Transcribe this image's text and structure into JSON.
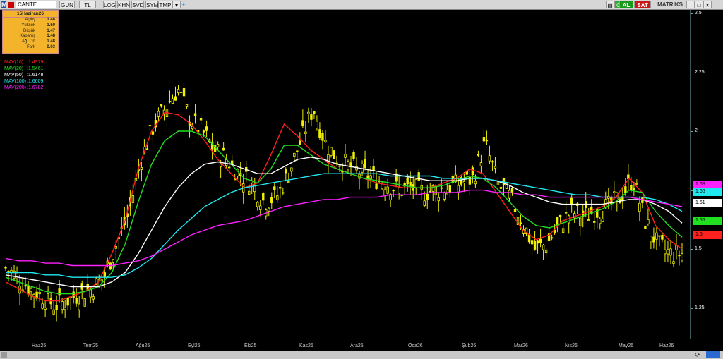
{
  "toolbar": {
    "symbol": "CANTE",
    "buttons": [
      "GUN",
      "TL",
      "LOG",
      "KHN",
      "SVD",
      "SYM",
      "TMP"
    ],
    "right_buttons": {
      "c": "C",
      "al": "AL",
      "sat": "SAT"
    },
    "brand": "MATRIKS"
  },
  "infobox": {
    "date": "15Haziran26",
    "rows": [
      {
        "k": "Açılış",
        "v": "1.48"
      },
      {
        "k": "Yüksek",
        "v": "1.50"
      },
      {
        "k": "Düşük",
        "v": "1.47"
      },
      {
        "k": "Kapanış",
        "v": "1.48"
      },
      {
        "k": "Ağ. Ort",
        "v": "1.48"
      },
      {
        "k": "Fark",
        "v": "0.03"
      }
    ]
  },
  "mav_legend": [
    {
      "name": "MAV(10)",
      "value": ":1.4979",
      "color": "#ff2020"
    },
    {
      "name": "MAV(20)",
      "value": ":1.5461",
      "color": "#20e020"
    },
    {
      "name": "MAV(50)",
      "value": ":1.6148",
      "color": "#ffffff"
    },
    {
      "name": "MAV(100)",
      "value": ":1.6609",
      "color": "#20e8f0"
    },
    {
      "name": "MAV(200)",
      "value": ":1.6782",
      "color": "#ff20ff"
    }
  ],
  "chart_data": {
    "type": "line",
    "ylim": [
      1.15,
      2.5
    ],
    "y_ticks": [
      "2.5",
      "2.25",
      "2",
      "1.75",
      "1.5",
      "1.25"
    ],
    "x_ticks": [
      "Haz25",
      "Tem25",
      "Ağu25",
      "Eyl25",
      "Eki25",
      "Kas25",
      "Ara25",
      "Oca26",
      "Şub26",
      "Mar26",
      "Nis26",
      "May26",
      "Haz26"
    ],
    "price_badges": [
      {
        "label": "1.68",
        "color": "#ff20ff"
      },
      {
        "label": "1.66",
        "color": "#20e8f0"
      },
      {
        "label": "1.61",
        "color": "#ffffff"
      },
      {
        "label": "1.55",
        "color": "#20e020"
      },
      {
        "label": "1.5",
        "color": "#ff2020"
      }
    ],
    "close_approx": [
      1.42,
      1.38,
      1.33,
      1.3,
      1.26,
      1.28,
      1.31,
      1.33,
      1.38,
      1.52,
      1.65,
      1.88,
      2.02,
      2.1,
      2.18,
      2.05,
      2.0,
      1.92,
      1.88,
      1.82,
      1.78,
      1.7,
      1.72,
      1.82,
      1.96,
      2.1,
      1.95,
      1.88,
      1.85,
      1.82,
      1.8,
      1.78,
      1.75,
      1.76,
      1.74,
      1.75,
      1.76,
      1.78,
      1.8,
      1.95,
      1.78,
      1.72,
      1.62,
      1.5,
      1.52,
      1.6,
      1.66,
      1.64,
      1.66,
      1.68,
      1.72,
      1.8,
      1.62,
      1.52,
      1.48,
      1.48
    ],
    "series": [
      {
        "name": "MAV(10)",
        "color": "#ff2020",
        "values": [
          1.36,
          1.33,
          1.3,
          1.28,
          1.28,
          1.3,
          1.32,
          1.36,
          1.48,
          1.62,
          1.84,
          2.0,
          2.08,
          2.07,
          2.03,
          1.96,
          1.88,
          1.82,
          1.76,
          1.78,
          1.9,
          2.03,
          1.98,
          1.92,
          1.88,
          1.84,
          1.82,
          1.8,
          1.78,
          1.77,
          1.76,
          1.76,
          1.76,
          1.78,
          1.8,
          1.84,
          1.82,
          1.74,
          1.66,
          1.58,
          1.54,
          1.56,
          1.62,
          1.64,
          1.66,
          1.68,
          1.72,
          1.8,
          1.74,
          1.6,
          1.54,
          1.5
        ]
      },
      {
        "name": "MAV(20)",
        "color": "#20e020",
        "values": [
          1.38,
          1.36,
          1.34,
          1.32,
          1.31,
          1.31,
          1.32,
          1.34,
          1.4,
          1.52,
          1.7,
          1.86,
          1.96,
          2.0,
          2.0,
          1.98,
          1.92,
          1.86,
          1.8,
          1.78,
          1.84,
          1.94,
          1.94,
          1.9,
          1.86,
          1.84,
          1.82,
          1.8,
          1.79,
          1.78,
          1.77,
          1.76,
          1.76,
          1.77,
          1.79,
          1.81,
          1.8,
          1.76,
          1.7,
          1.64,
          1.6,
          1.59,
          1.61,
          1.63,
          1.65,
          1.67,
          1.7,
          1.75,
          1.74,
          1.66,
          1.6,
          1.55
        ]
      },
      {
        "name": "MAV(50)",
        "color": "#ffffff",
        "values": [
          1.39,
          1.38,
          1.37,
          1.36,
          1.35,
          1.34,
          1.34,
          1.34,
          1.36,
          1.4,
          1.48,
          1.58,
          1.68,
          1.76,
          1.82,
          1.86,
          1.87,
          1.86,
          1.84,
          1.82,
          1.82,
          1.85,
          1.88,
          1.89,
          1.88,
          1.86,
          1.85,
          1.84,
          1.83,
          1.82,
          1.81,
          1.8,
          1.79,
          1.79,
          1.79,
          1.8,
          1.8,
          1.79,
          1.77,
          1.74,
          1.72,
          1.7,
          1.69,
          1.69,
          1.69,
          1.69,
          1.7,
          1.71,
          1.71,
          1.69,
          1.66,
          1.61
        ]
      },
      {
        "name": "MAV(100)",
        "color": "#20e8f0",
        "values": [
          1.4,
          1.4,
          1.4,
          1.39,
          1.39,
          1.38,
          1.38,
          1.38,
          1.38,
          1.39,
          1.42,
          1.46,
          1.52,
          1.58,
          1.63,
          1.68,
          1.71,
          1.74,
          1.76,
          1.77,
          1.78,
          1.79,
          1.8,
          1.81,
          1.82,
          1.82,
          1.82,
          1.82,
          1.82,
          1.81,
          1.81,
          1.81,
          1.81,
          1.8,
          1.8,
          1.8,
          1.8,
          1.79,
          1.78,
          1.77,
          1.76,
          1.75,
          1.74,
          1.73,
          1.73,
          1.72,
          1.72,
          1.72,
          1.72,
          1.71,
          1.69,
          1.66
        ]
      },
      {
        "name": "MAV(200)",
        "color": "#ff20ff",
        "values": [
          1.46,
          1.45,
          1.45,
          1.44,
          1.44,
          1.43,
          1.43,
          1.43,
          1.43,
          1.44,
          1.45,
          1.47,
          1.5,
          1.53,
          1.56,
          1.58,
          1.6,
          1.61,
          1.62,
          1.64,
          1.66,
          1.68,
          1.69,
          1.7,
          1.71,
          1.71,
          1.72,
          1.72,
          1.72,
          1.73,
          1.73,
          1.73,
          1.74,
          1.74,
          1.74,
          1.75,
          1.75,
          1.74,
          1.74,
          1.73,
          1.73,
          1.72,
          1.72,
          1.72,
          1.72,
          1.72,
          1.72,
          1.72,
          1.71,
          1.7,
          1.69,
          1.68
        ]
      }
    ]
  }
}
